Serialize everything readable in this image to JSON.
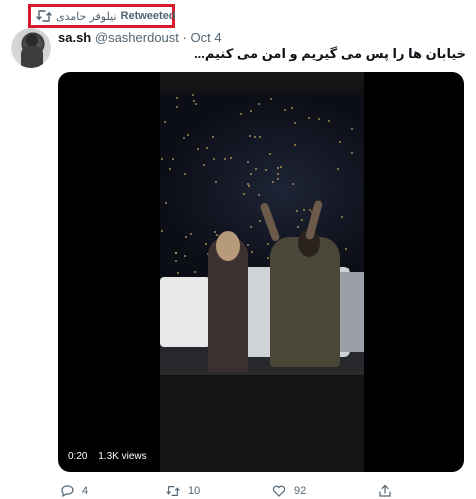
{
  "retweet": {
    "name": "نیلوفر حامدی",
    "label": "Retweeted"
  },
  "tweet": {
    "display_name": "sa.sh",
    "handle": "@sasherdoust",
    "separator": "·",
    "date": "Oct 4",
    "text": "خیابان ها را پس می گیریم و امن می کنیم..."
  },
  "media": {
    "duration": "0:20",
    "views": "1.3K views"
  },
  "actions": {
    "replies": "4",
    "retweets": "10",
    "likes": "92"
  },
  "colors": {
    "highlight_border": "#d81b2a",
    "secondary_text": "#536471",
    "primary_text": "#0f1419"
  }
}
